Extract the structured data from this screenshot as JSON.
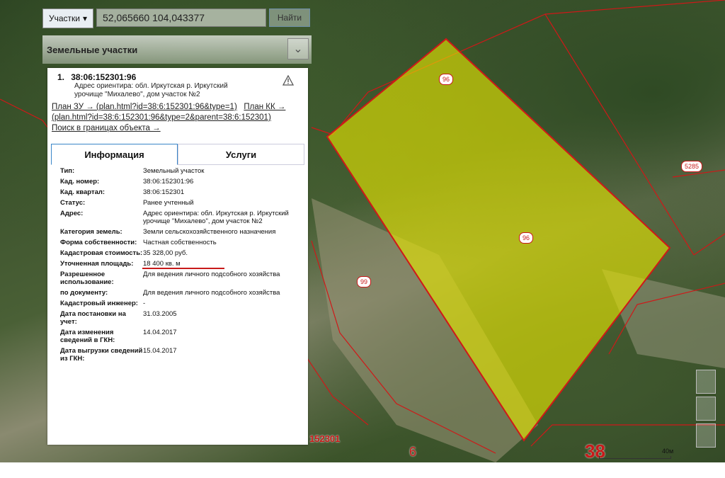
{
  "search": {
    "dropdown_label": "Участки",
    "query_value": "52,065660 104,043377",
    "find_label": "Найти"
  },
  "panel": {
    "title": "Земельные участки",
    "result": {
      "index": "1.",
      "cad_number": "38:06:152301:96",
      "address_line1": "Адрес ориентира: обл. Иркутская р. Иркутский",
      "address_line2": "урочище \"Михалево\", дом участок №2"
    },
    "links_text_1": "План ЗУ → (plan.html?id=38:6:152301:96&type=1)",
    "links_text_2": "План КК → (plan.html?id=38:6:152301:96&type=2&parent=38:6:152301)",
    "links_text_3": "Поиск в границах объекта →",
    "tabs": [
      {
        "label": "Информация"
      },
      {
        "label": "Услуги"
      }
    ],
    "properties": [
      {
        "label": "Тип:",
        "value": "Земельный участок"
      },
      {
        "label": "Кад. номер:",
        "value": "38:06:152301:96"
      },
      {
        "label": "Кад. квартал:",
        "value": "38:06:152301"
      },
      {
        "label": "Статус:",
        "value": "Ранее учтенный"
      },
      {
        "label": "Адрес:",
        "value": "Адрес ориентира: обл. Иркутская р. Иркутский урочище \"Михалево\", дом участок №2"
      },
      {
        "label": "Категория земель:",
        "value": "Земли сельскохозяйственного назначения"
      },
      {
        "label": "Форма собственности:",
        "value": "Частная собственность"
      },
      {
        "label": "Кадастровая стоимость:",
        "value": "35 328,00 руб."
      },
      {
        "label": "Уточненная площадь:",
        "value": "18 400 кв. м"
      },
      {
        "label": "Разрешенное использование:",
        "value": "Для ведения личного подсобного хозяйства"
      },
      {
        "label": "по документу:",
        "value": "Для ведения личного подсобного хозяйства"
      },
      {
        "label": "Кадастровый инженер:",
        "value": "-"
      },
      {
        "label": "Дата постановки на учет:",
        "value": "31.03.2005"
      },
      {
        "label": "Дата изменения сведений в ГКН:",
        "value": "14.04.2017"
      },
      {
        "label": "Дата выгрузки сведений из ГКН:",
        "value": "15.04.2017"
      }
    ]
  },
  "map": {
    "labels": {
      "parcel_96_top": "96",
      "parcel_96_center": "96",
      "parcel_99": "99",
      "parcel_5285": "5285",
      "quarter": "152301",
      "label_6": "6",
      "label_38": "38"
    },
    "scale_text": "40м",
    "colors": {
      "highlight": "#e6e600",
      "boundary": "#d01818"
    }
  }
}
